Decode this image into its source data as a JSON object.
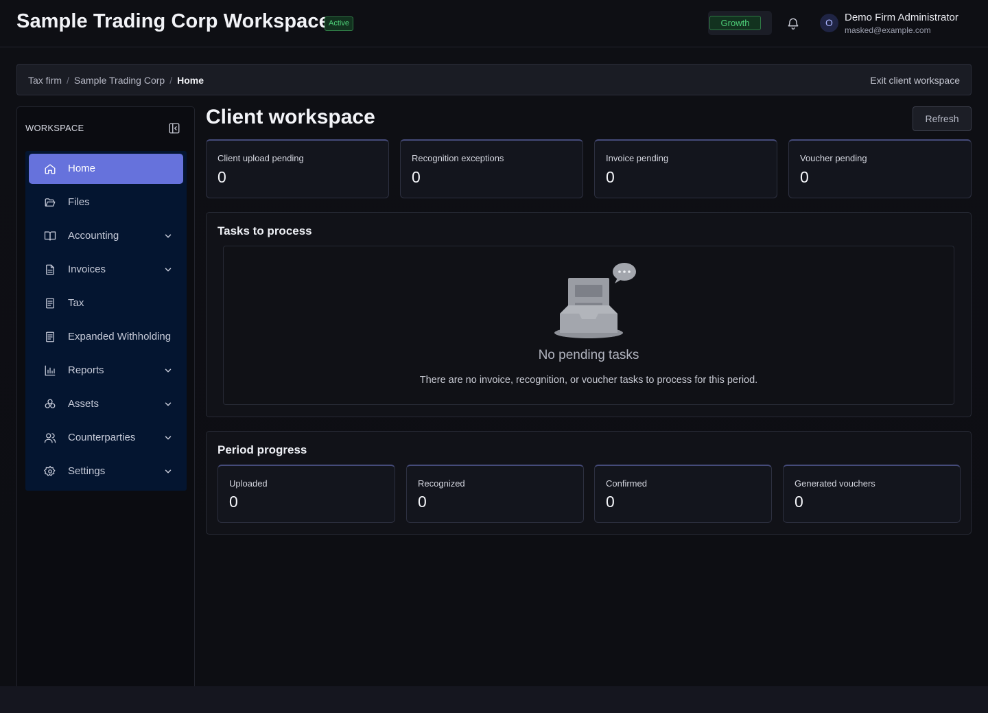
{
  "header": {
    "title": "Sample Trading Corp Workspace",
    "status_badge": "Active",
    "plan_badge": "Growth",
    "user": {
      "avatar_initial": "O",
      "name": "Demo Firm Administrator",
      "email": "masked@example.com"
    }
  },
  "breadcrumb": {
    "items": [
      "Tax firm",
      "Sample Trading Corp",
      "Home"
    ],
    "exit_label": "Exit client workspace"
  },
  "sidebar": {
    "title": "WORKSPACE",
    "items": [
      {
        "label": "Home",
        "icon": "home-icon",
        "active": true,
        "has_children": false
      },
      {
        "label": "Files",
        "icon": "folder-open-icon",
        "active": false,
        "has_children": false
      },
      {
        "label": "Accounting",
        "icon": "book-open-icon",
        "active": false,
        "has_children": true
      },
      {
        "label": "Invoices",
        "icon": "document-icon",
        "active": false,
        "has_children": true
      },
      {
        "label": "Tax",
        "icon": "receipt-icon",
        "active": false,
        "has_children": false
      },
      {
        "label": "Expanded Withholding Tax",
        "icon": "receipt-icon",
        "active": false,
        "has_children": false
      },
      {
        "label": "Reports",
        "icon": "bar-chart-icon",
        "active": false,
        "has_children": true
      },
      {
        "label": "Assets",
        "icon": "cubes-icon",
        "active": false,
        "has_children": true
      },
      {
        "label": "Counterparties",
        "icon": "users-icon",
        "active": false,
        "has_children": true
      },
      {
        "label": "Settings",
        "icon": "gear-icon",
        "active": false,
        "has_children": true
      }
    ]
  },
  "main": {
    "title": "Client workspace",
    "refresh_label": "Refresh",
    "stats": [
      {
        "label": "Client upload pending",
        "value": "0"
      },
      {
        "label": "Recognition exceptions",
        "value": "0"
      },
      {
        "label": "Invoice pending",
        "value": "0"
      },
      {
        "label": "Voucher pending",
        "value": "0"
      }
    ],
    "tasks": {
      "title": "Tasks to process",
      "empty_title": "No pending tasks",
      "empty_description": "There are no invoice, recognition, or voucher tasks to process for this period."
    },
    "progress": {
      "title": "Period progress",
      "items": [
        {
          "label": "Uploaded",
          "value": "0"
        },
        {
          "label": "Recognized",
          "value": "0"
        },
        {
          "label": "Confirmed",
          "value": "0"
        },
        {
          "label": "Generated vouchers",
          "value": "0"
        }
      ]
    }
  },
  "colors": {
    "accent": "#6672dc",
    "success": "#4fd17a",
    "nav_background": "#041530"
  }
}
